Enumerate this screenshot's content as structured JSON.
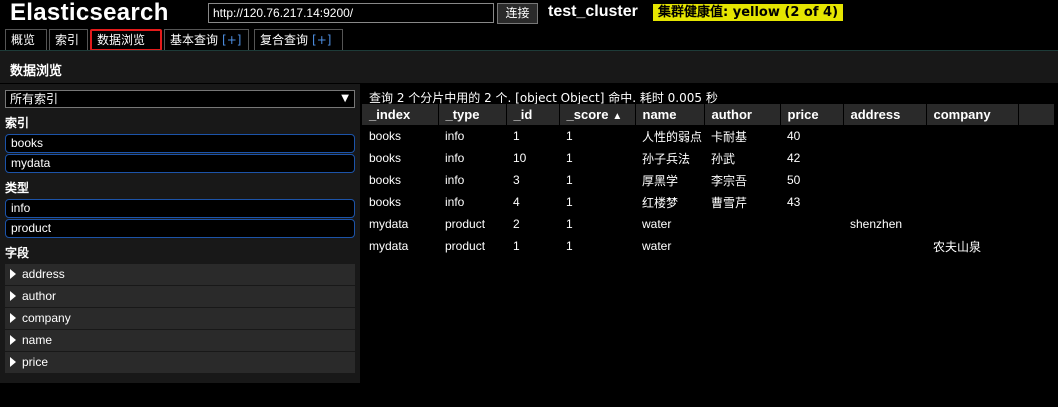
{
  "header": {
    "app_title": "Elasticsearch",
    "url_value": "http://120.76.217.14:9200/",
    "connect_label": "连接",
    "cluster_name": "test_cluster",
    "health": "集群健康值: yellow (2 of 4)",
    "health_color": "#e5e500"
  },
  "tabs": [
    {
      "label": "概览"
    },
    {
      "label": "索引"
    },
    {
      "label": "数据浏览"
    },
    {
      "label": "基本查询",
      "plus": "[+]"
    },
    {
      "label": "复合查询",
      "plus": "[+]"
    }
  ],
  "section_title": "数据浏览",
  "sidebar": {
    "index_select": "所有索引",
    "indices_label": "索引",
    "indices": [
      "books",
      "mydata"
    ],
    "types_label": "类型",
    "types": [
      "info",
      "product"
    ],
    "fields_label": "字段",
    "fields": [
      "address",
      "author",
      "company",
      "name",
      "price"
    ]
  },
  "results": {
    "summary": "查询 2 个分片中用的 2 个. [object Object] 命中. 耗时 0.005 秒",
    "columns": [
      "_index",
      "_type",
      "_id",
      "_score",
      "name",
      "author",
      "price",
      "address",
      "company",
      ""
    ],
    "sort_column": "_score",
    "sort_indicator": "▲",
    "rows": [
      [
        "books",
        "info",
        "1",
        "1",
        "人性的弱点",
        "卡耐基",
        "40",
        "",
        ""
      ],
      [
        "books",
        "info",
        "10",
        "1",
        "孙子兵法",
        "孙武",
        "42",
        "",
        ""
      ],
      [
        "books",
        "info",
        "3",
        "1",
        "厚黑学",
        "李宗吾",
        "50",
        "",
        ""
      ],
      [
        "books",
        "info",
        "4",
        "1",
        "红楼梦",
        "曹雪芹",
        "43",
        "",
        ""
      ],
      [
        "mydata",
        "product",
        "2",
        "1",
        "water",
        "",
        "",
        "shenzhen",
        ""
      ],
      [
        "mydata",
        "product",
        "1",
        "1",
        "water",
        "",
        "",
        "",
        "农夫山泉"
      ]
    ]
  },
  "colors": {
    "accent_blue": "#4d8ee0",
    "active_tab_border": "#e31b1b",
    "filter_border": "#1c53a8"
  }
}
